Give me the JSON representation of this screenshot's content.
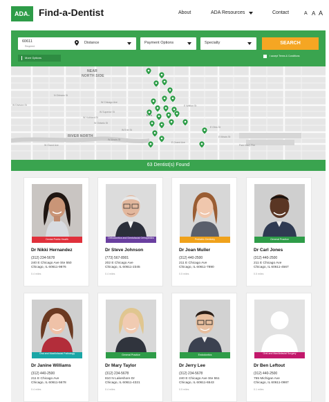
{
  "header": {
    "logo": "ADA.",
    "title": "Find-a-Dentist",
    "nav": {
      "about": "About",
      "resources": "ADA Resources",
      "contact": "Contact"
    },
    "font_sizes": [
      "A",
      "A",
      "A"
    ]
  },
  "search": {
    "zip_value": "60611",
    "zip_hint": "Required",
    "distance": "Distance",
    "payment": "Payment Options",
    "specialty": "Specialty",
    "button": "SEARCH",
    "more_options": "More Options",
    "accept_label": "I accept Terms & Conditions"
  },
  "map": {
    "labels": [
      "NEAR",
      "NORTH SIDE",
      "RIVER NORTH",
      "MA"
    ],
    "streets": [
      "W Chicago Ave",
      "W Erie St",
      "E Grand Ave",
      "W Grand Ave",
      "E Illinois St",
      "W Division St",
      "E Walton St",
      "Park Navy Pier",
      "W Ontario St",
      "E Ohio St",
      "W Superior St",
      "W Illinois St",
      "N Orleans St",
      "W Hubbard St"
    ],
    "pin_color": "#2e9c48",
    "pin_icon": "map-pin-icon"
  },
  "results": {
    "text": "63 Dentist(s) Found"
  },
  "dentists": [
    {
      "name": "Dr Nikki Hernandez",
      "tag": "Dental Public Health",
      "tag_color": "#e0303b",
      "phone": "(312) 234-5678",
      "addr1": "240 E Chicago Ave Ste 550",
      "addr2": "Chicago, IL 60611-9876",
      "distance": "0.4 miles"
    },
    {
      "name": "Dr Steve Johnson",
      "tag": "Orthodontics and Dentofacial Orthopedics",
      "tag_color": "#6a3fa0",
      "phone": "(773) 567-8901",
      "addr1": "202 E Chicago Ave",
      "addr2": "Chicago, IL 60611-2345",
      "distance": "0.4 miles"
    },
    {
      "name": "Dr Joan Muller",
      "tag": "Pediatric Dentistry",
      "tag_color": "#f0a21b",
      "phone": "(312) 440-2500",
      "addr1": "211 E Chicago Ave",
      "addr2": "Chicago, IL 60611-7890",
      "distance": "0.5 miles"
    },
    {
      "name": "Dr Carl Jones",
      "tag": "General Practice",
      "tag_color": "#2e9c48",
      "phone": "(312) 440-2500",
      "addr1": "211 E Chicago Ave",
      "addr2": "Chicago, IL 60611-4567",
      "distance": "0.5 miles"
    },
    {
      "name": "Dr Janine Williams",
      "tag": "Oral and Maxillofacial Pathology",
      "tag_color": "#1aa6a6",
      "phone": "(312) 440-2500",
      "addr1": "211 E Chicago Ave",
      "addr2": "Chicago, IL 60611-5678",
      "distance": "0.4 miles"
    },
    {
      "name": "Dr Mary Taylor",
      "tag": "General Practice",
      "tag_color": "#2e9c48",
      "phone": "(312) 234-5678",
      "addr1": "810 N Lakeshore Dr",
      "addr2": "Chicago, IL 60611-4321",
      "distance": "0.4 miles"
    },
    {
      "name": "Dr Jerry Lee",
      "tag": "Endodontics",
      "tag_color": "#2e9c48",
      "phone": "(312) 234-5678",
      "addr1": "240 E Chicago Ave Ste 551",
      "addr2": "Chicago, IL 60611-6543",
      "distance": "0.5 miles"
    },
    {
      "name": "Dr Ben Leftout",
      "tag": "Oral and Maxillofacial Surgery",
      "tag_color": "#c2186b",
      "phone": "(312) 440-2500",
      "addr1": "755 Michigan Ave",
      "addr2": "Chicago, IL 60611-0987",
      "distance": "0.1 miles"
    }
  ]
}
